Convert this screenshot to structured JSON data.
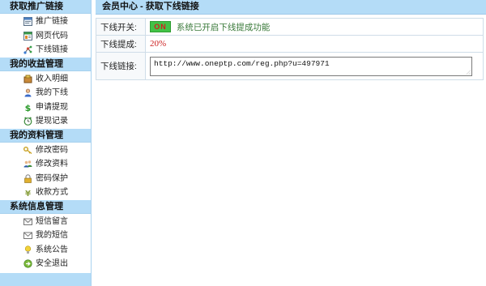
{
  "sidebar": {
    "sections": [
      {
        "title": "获取推广链接",
        "items": [
          {
            "label": "推广链接",
            "icon": "window-icon"
          },
          {
            "label": "网页代码",
            "icon": "webpage-icon"
          },
          {
            "label": "下线链接",
            "icon": "network-icon"
          }
        ]
      },
      {
        "title": "我的收益管理",
        "items": [
          {
            "label": "收入明细",
            "icon": "money-box-icon"
          },
          {
            "label": "我的下线",
            "icon": "user-icon"
          },
          {
            "label": "申请提现",
            "icon": "dollar-icon"
          },
          {
            "label": "提现记录",
            "icon": "clock-icon"
          }
        ]
      },
      {
        "title": "我的资料管理",
        "items": [
          {
            "label": "修改密码",
            "icon": "key-icon"
          },
          {
            "label": "修改资料",
            "icon": "users-icon"
          },
          {
            "label": "密码保护",
            "icon": "lock-icon"
          },
          {
            "label": "收款方式",
            "icon": "yen-icon"
          }
        ]
      },
      {
        "title": "系统信息管理",
        "items": [
          {
            "label": "短信留言",
            "icon": "envelope-icon"
          },
          {
            "label": "我的短信",
            "icon": "mail-icon"
          },
          {
            "label": "系统公告",
            "icon": "lightbulb-icon"
          },
          {
            "label": "安全退出",
            "icon": "exit-icon"
          }
        ]
      }
    ]
  },
  "main": {
    "header": "会员中心 - 获取下线链接",
    "switch_label": "下线开关:",
    "switch_badge": "ON",
    "switch_text": "系统已开启下线提成功能",
    "commission_label": "下线提成:",
    "commission_value": "20%",
    "link_label": "下线链接:",
    "link_value": "http://www.oneptp.com/reg.php?u=497971"
  },
  "colors": {
    "header_bg": "#b4dcf7",
    "on_badge_bg": "#42c247",
    "on_badge_text": "#d41e1e",
    "commission_text": "#cc1f1f"
  }
}
